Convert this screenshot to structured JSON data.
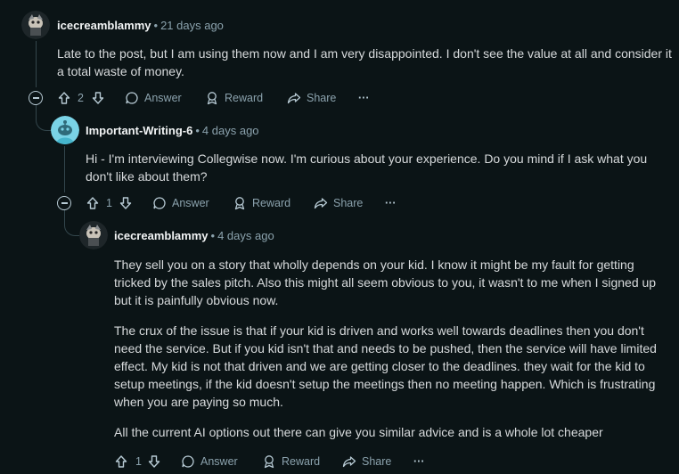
{
  "comments": [
    {
      "user": "icecreamblammy",
      "time": "21 days ago",
      "paragraphs": [
        "Late to the post, but I am using them now and I am very disappointed. I don't see the value at all and consider it a total waste of money."
      ],
      "votes": "2",
      "answer": "Answer",
      "reward": "Reward",
      "share": "Share",
      "more": "···"
    },
    {
      "user": "Important-Writing-6",
      "time": "4 days ago",
      "paragraphs": [
        "Hi - I'm interviewing Collegwise now. I'm curious about your experience. Do you mind if I ask what you don't like about them?"
      ],
      "votes": "1",
      "answer": "Answer",
      "reward": "Reward",
      "share": "Share",
      "more": "···"
    },
    {
      "user": "icecreamblammy",
      "time": "4 days ago",
      "paragraphs": [
        "They sell you on a story that wholly depends on your kid. I know it might be my fault for getting tricked by the sales pitch. Also this might all seem obvious to you, it wasn't to me when I signed up but it is painfully obvious now.",
        "The crux of the issue is that if your kid is driven and works well towards deadlines then you don't need the service. But if you kid isn't that and needs to be pushed, then the service will have limited effect. My kid is not that driven and we are getting closer to the deadlines. they wait for the kid to setup meetings, if the kid doesn't setup the meetings then no meeting happen. Which is frustrating when you are paying so much.",
        "All the current AI options out there can give you similar advice and is a whole lot cheaper"
      ],
      "votes": "1",
      "answer": "Answer",
      "reward": "Reward",
      "share": "Share",
      "more": "···"
    }
  ],
  "separator": "•",
  "colors": {
    "background": "#0b1416",
    "text": "#d7dadc",
    "muted": "#8ba2ad",
    "thread": "#33464c"
  }
}
